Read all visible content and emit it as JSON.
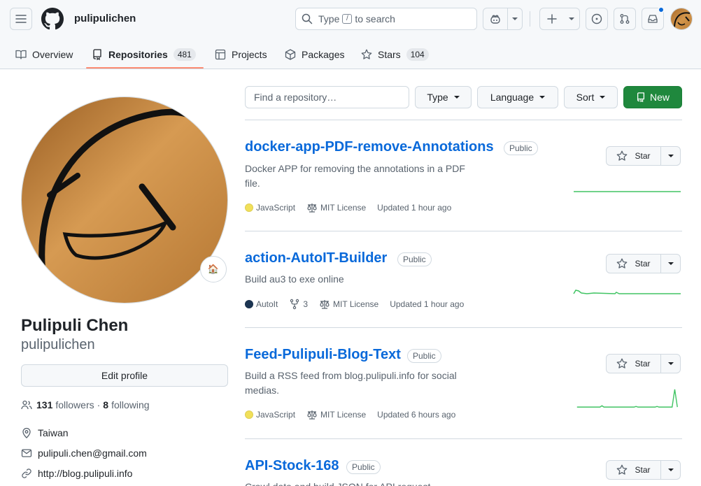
{
  "header": {
    "username": "pulipulichen",
    "search_prefix": "Type",
    "search_key": "/",
    "search_suffix": "to search"
  },
  "tabs": [
    {
      "label": "Overview",
      "icon": "book-icon"
    },
    {
      "label": "Repositories",
      "count": "481",
      "icon": "repo-icon",
      "active": true
    },
    {
      "label": "Projects",
      "icon": "table-icon"
    },
    {
      "label": "Packages",
      "icon": "package-icon"
    },
    {
      "label": "Stars",
      "count": "104",
      "icon": "star-icon"
    }
  ],
  "profile": {
    "full_name": "Pulipuli Chen",
    "login": "pulipulichen",
    "status_emoji": "🏠",
    "edit_label": "Edit profile",
    "followers_count": "131",
    "followers_label": "followers",
    "dot": "·",
    "following_count": "8",
    "following_label": "following",
    "location": "Taiwan",
    "email": "pulipuli.chen@gmail.com",
    "website": "http://blog.pulipuli.info"
  },
  "filters": {
    "find_placeholder": "Find a repository…",
    "type_label": "Type",
    "language_label": "Language",
    "sort_label": "Sort",
    "new_label": "New"
  },
  "repos": [
    {
      "name": "docker-app-PDF-remove-Annotations",
      "visibility": "Public",
      "description": "Docker APP for removing the annotations in a PDF file.",
      "language": "JavaScript",
      "language_color": "#f1e05a",
      "license": "MIT License",
      "updated": "Updated 1 hour ago",
      "star_label": "Star"
    },
    {
      "name": "action-AutoIT-Builder",
      "visibility": "Public",
      "description": "Build au3 to exe online",
      "language": "AutoIt",
      "language_color": "#1c3552",
      "forks": "3",
      "license": "MIT License",
      "updated": "Updated 1 hour ago",
      "star_label": "Star"
    },
    {
      "name": "Feed-Pulipuli-Blog-Text",
      "visibility": "Public",
      "description": "Build a RSS feed from blog.pulipuli.info for social medias.",
      "language": "JavaScript",
      "language_color": "#f1e05a",
      "license": "MIT License",
      "updated": "Updated 6 hours ago",
      "star_label": "Star"
    },
    {
      "name": "API-Stock-168",
      "visibility": "Public",
      "description": "Crawl data and build JSON for API request",
      "star_label": "Star"
    }
  ],
  "colors": {
    "link": "#0969da",
    "primary_button": "#1f883d",
    "tab_underline": "#fd8c73",
    "sparkline": "#40c463",
    "avatar": "#c98a40"
  }
}
